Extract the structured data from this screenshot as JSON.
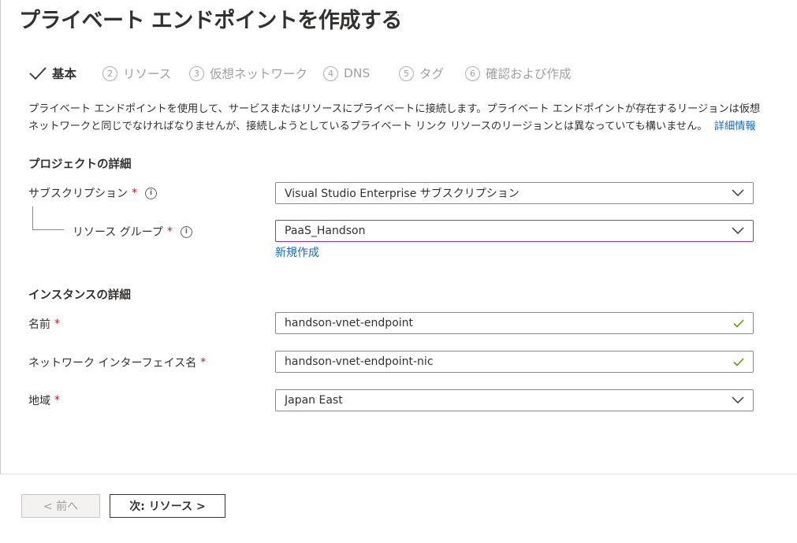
{
  "header": {
    "title": "プライベート エンドポイントを作成する",
    "more": "···"
  },
  "tabs": [
    {
      "num": "",
      "label": "基本",
      "state": "complete-active"
    },
    {
      "num": "2",
      "label": "リソース",
      "state": "disabled"
    },
    {
      "num": "3",
      "label": "仮想ネットワーク",
      "state": "disabled"
    },
    {
      "num": "4",
      "label": "DNS",
      "state": "disabled"
    },
    {
      "num": "5",
      "label": "タグ",
      "state": "disabled"
    },
    {
      "num": "6",
      "label": "確認および作成",
      "state": "disabled"
    }
  ],
  "description": {
    "text": "プライベート エンドポイントを使用して、サービスまたはリソースにプライベートに接続します。プライベート エンドポイントが存在するリージョンは仮想ネットワークと同じでなければなりませんが、接続しようとしているプライベート リンク リソースのリージョンとは異なっていても構いません。",
    "link": "詳細情報"
  },
  "project": {
    "heading": "プロジェクトの詳細",
    "subscription": {
      "label": "サブスクリプション",
      "required": "*",
      "info_icon": "i",
      "value": "Visual Studio Enterprise サブスクリプション"
    },
    "resource_group": {
      "label": "リソース グループ",
      "required": "*",
      "info_icon": "i",
      "value": "PaaS_Handson",
      "create_new": "新規作成"
    }
  },
  "instance": {
    "heading": "インスタンスの詳細",
    "name": {
      "label": "名前",
      "required": "*",
      "value": "handson-vnet-endpoint"
    },
    "nic_name": {
      "label": "ネットワーク インターフェイス名",
      "required": "*",
      "value": "handson-vnet-endpoint-nic"
    },
    "region": {
      "label": "地域",
      "required": "*",
      "value": "Japan East"
    }
  },
  "footer": {
    "prev": "< 前へ",
    "next": "次: リソース >"
  },
  "colors": {
    "accent_link": "#0f6cbd",
    "required": "#a4262c",
    "valid": "#57a300",
    "focus_border": "#8a3ab9"
  }
}
